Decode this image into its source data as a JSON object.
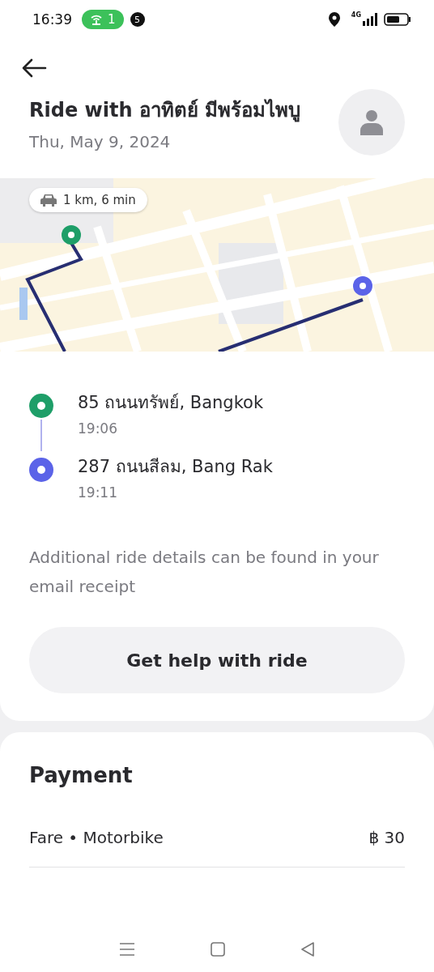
{
  "status_bar": {
    "time": "16:39",
    "hotspot_count": "1",
    "notification_count": "5",
    "network": "4G"
  },
  "header": {
    "title": "Ride with อาทิตย์ มีพร้อมไพบู",
    "date": "Thu, May 9, 2024"
  },
  "map": {
    "kind": "picture",
    "route_chip": "1 km, 6 min"
  },
  "stops": [
    {
      "address": "85 ถนนทรัพย์, Bangkok",
      "time": "19:06",
      "color": "#1e9e68"
    },
    {
      "address": "287 ถนนสีลม, Bang Rak",
      "time": "19:11",
      "color": "#5b63e8"
    }
  ],
  "note": "Additional ride details can be found in your email receipt",
  "help_button": "Get help with ride",
  "payment": {
    "title": "Payment",
    "items": [
      {
        "label": "Fare • Motorbike",
        "amount": "฿ 30"
      }
    ]
  }
}
